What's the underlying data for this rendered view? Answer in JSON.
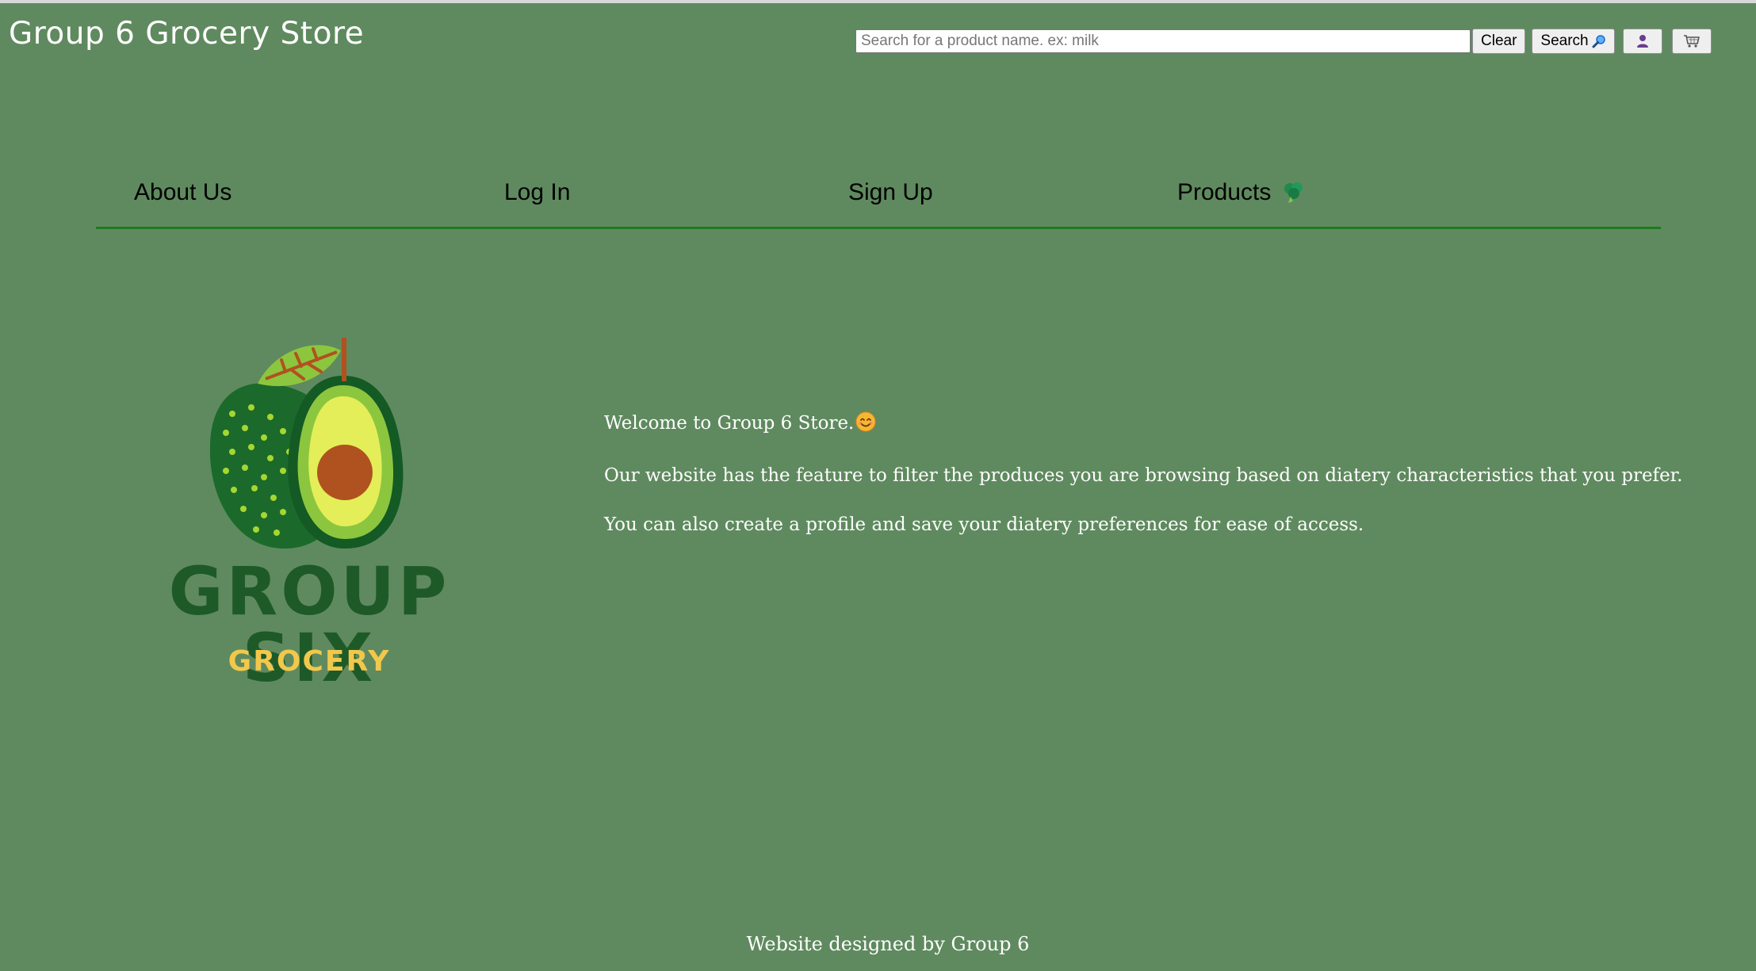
{
  "header": {
    "title": "Group 6 Grocery Store",
    "search": {
      "placeholder": "Search for a product name. ex: milk",
      "value": ""
    },
    "clear_label": "Clear",
    "search_label": "Search",
    "search_icon": "magnifier-icon",
    "user_icon": "user-icon",
    "cart_icon": "cart-icon"
  },
  "nav": {
    "items": [
      {
        "label": "About Us"
      },
      {
        "label": "Log In"
      },
      {
        "label": "Sign Up"
      },
      {
        "label": "Products",
        "icon": "broccoli-icon"
      }
    ]
  },
  "logo": {
    "title": "GROUP SIX",
    "subtitle": "GROCERY",
    "icon": "avocado-logo"
  },
  "welcome": {
    "line1": "Welcome to Group 6 Store.",
    "line2": "Our website has the feature to filter the produces you are browsing based on diatery characteristics that you prefer.",
    "line3": "You can also create a profile and save your diatery preferences for ease of access.",
    "emoji_icon": "smiley-icon"
  },
  "footer": {
    "text": "Website designed by Group 6"
  },
  "colors": {
    "background": "#5f8a5f",
    "nav_underline": "#1f7a1f",
    "logo_green": "#1e5a28",
    "logo_yellow": "#f2c84b"
  }
}
